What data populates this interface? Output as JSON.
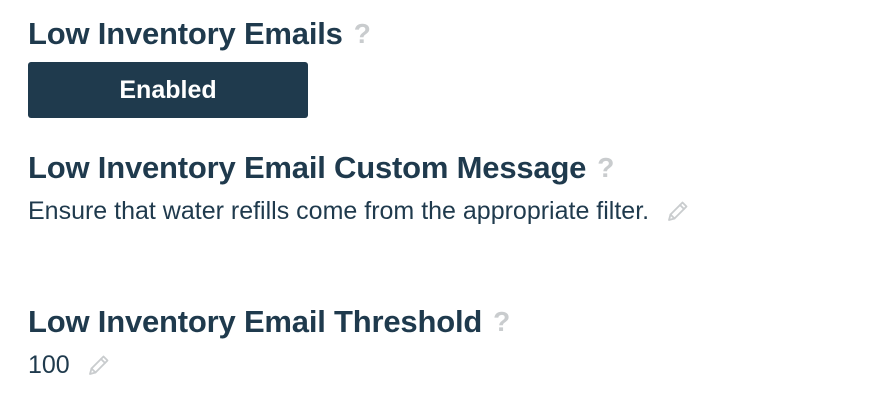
{
  "low_inventory_emails": {
    "label": "Low Inventory Emails",
    "help": "?",
    "toggle_label": "Enabled"
  },
  "custom_message": {
    "label": "Low Inventory Email Custom Message",
    "help": "?",
    "value": "Ensure that water refills come from the appropriate filter.",
    "edit_icon": "pencil-icon"
  },
  "threshold": {
    "label": "Low Inventory Email Threshold",
    "help": "?",
    "value": "100",
    "edit_icon": "pencil-icon"
  },
  "colors": {
    "primary": "#1f3a4d",
    "help_icon": "#c9ccce",
    "edit_icon": "#c9ccce",
    "button_text": "#ffffff"
  }
}
